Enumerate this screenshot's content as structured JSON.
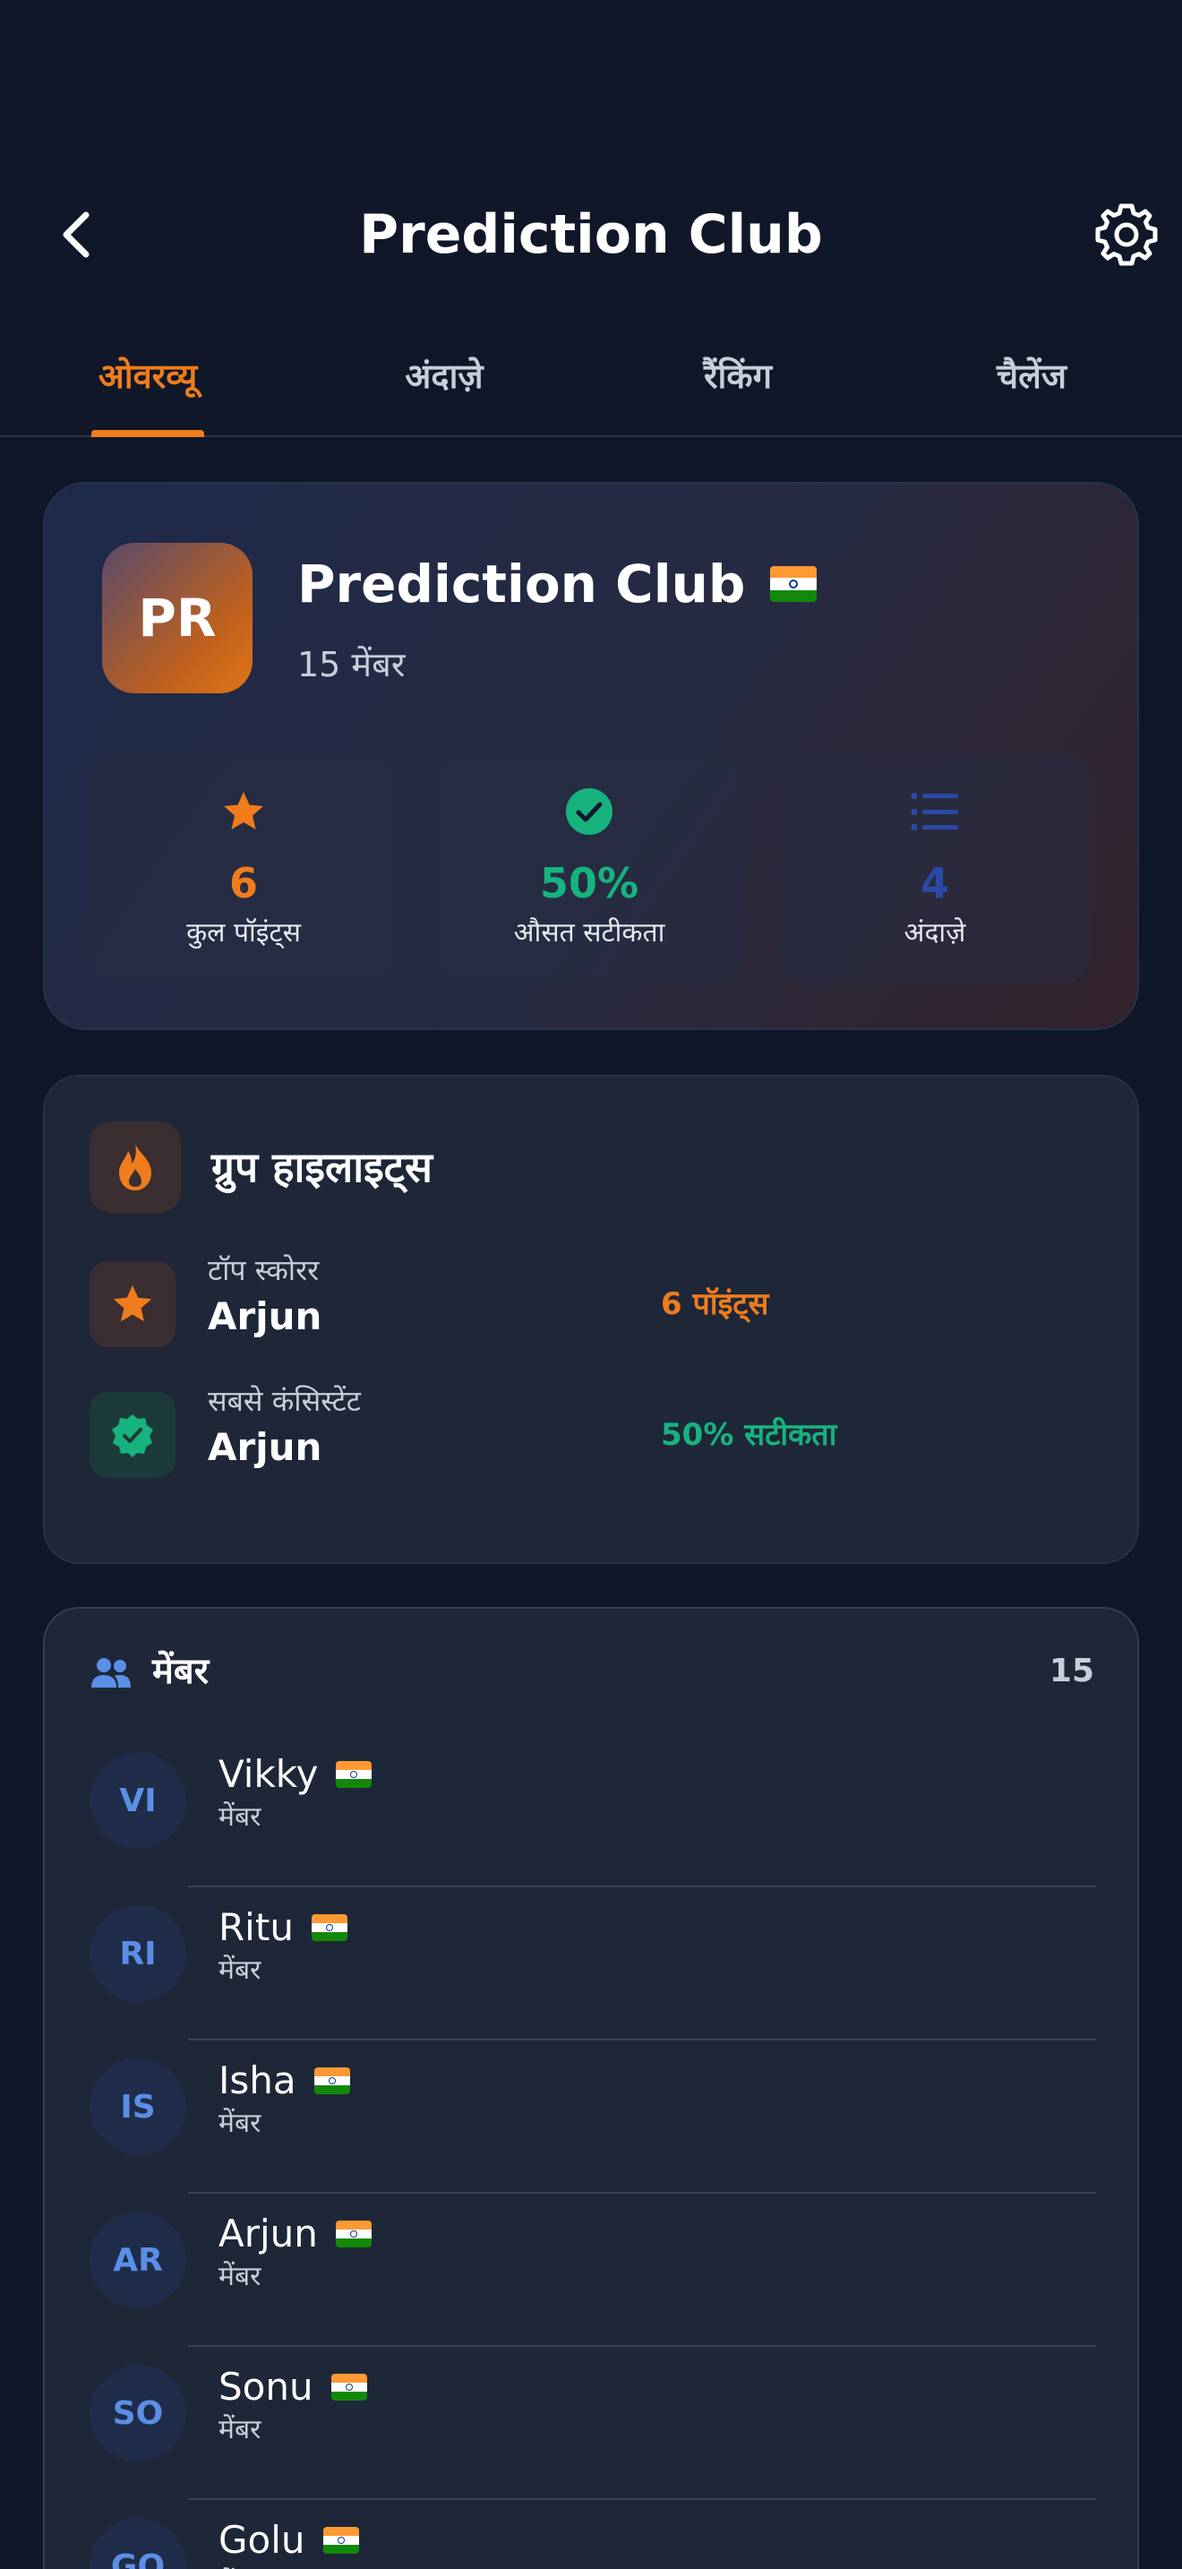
{
  "header": {
    "title": "Prediction Club",
    "back_icon": "chevron-left-icon",
    "settings_icon": "gear-icon"
  },
  "tabs": [
    {
      "label": "ओवरव्यू",
      "active": true
    },
    {
      "label": "अंदाज़े",
      "active": false
    },
    {
      "label": "रैंकिंग",
      "active": false
    },
    {
      "label": "चैलेंज",
      "active": false
    }
  ],
  "club": {
    "initials": "PR",
    "name": "Prediction Club",
    "members_text": "15 मेंबर",
    "stats": [
      {
        "icon": "star-icon",
        "value": "6",
        "label": "कुल पॉइंट्स",
        "color": "#f07c1c"
      },
      {
        "icon": "check-circle-icon",
        "value": "50%",
        "label": "औसत सटीकता",
        "color": "#16b37e"
      },
      {
        "icon": "list-icon",
        "value": "4",
        "label": "अंदाज़े",
        "color": "#2b4aa8"
      }
    ]
  },
  "highlights": {
    "title": "ग्रुप हाइलाइट्स",
    "icon": "flame-icon",
    "rows": [
      {
        "icon": "star-icon",
        "label": "टॉप स्कोरर",
        "name": "Arjun",
        "value": "6 पॉइंट्स",
        "color": "#f07c1c"
      },
      {
        "icon": "verified-badge-icon",
        "label": "सबसे कंसिस्टेंट",
        "name": "Arjun",
        "value": "50% सटीकता",
        "color": "#16b37e"
      }
    ]
  },
  "members": {
    "title": "मेंबर",
    "count": "15",
    "icon": "users-icon",
    "list": [
      {
        "initials": "VI",
        "name": "Vikky",
        "role": "मेंबर"
      },
      {
        "initials": "RI",
        "name": "Ritu",
        "role": "मेंबर"
      },
      {
        "initials": "IS",
        "name": "Isha",
        "role": "मेंबर"
      },
      {
        "initials": "AR",
        "name": "Arjun",
        "role": "मेंबर"
      },
      {
        "initials": "SO",
        "name": "Sonu",
        "role": "मेंबर"
      },
      {
        "initials": "GO",
        "name": "Golu",
        "role": "मेंबर"
      }
    ]
  },
  "colors": {
    "background": "#0f1729",
    "card": "#1e2738",
    "accent_orange": "#f07c1c",
    "accent_green": "#16b37e",
    "avatar_text": "#5b8fe6"
  }
}
